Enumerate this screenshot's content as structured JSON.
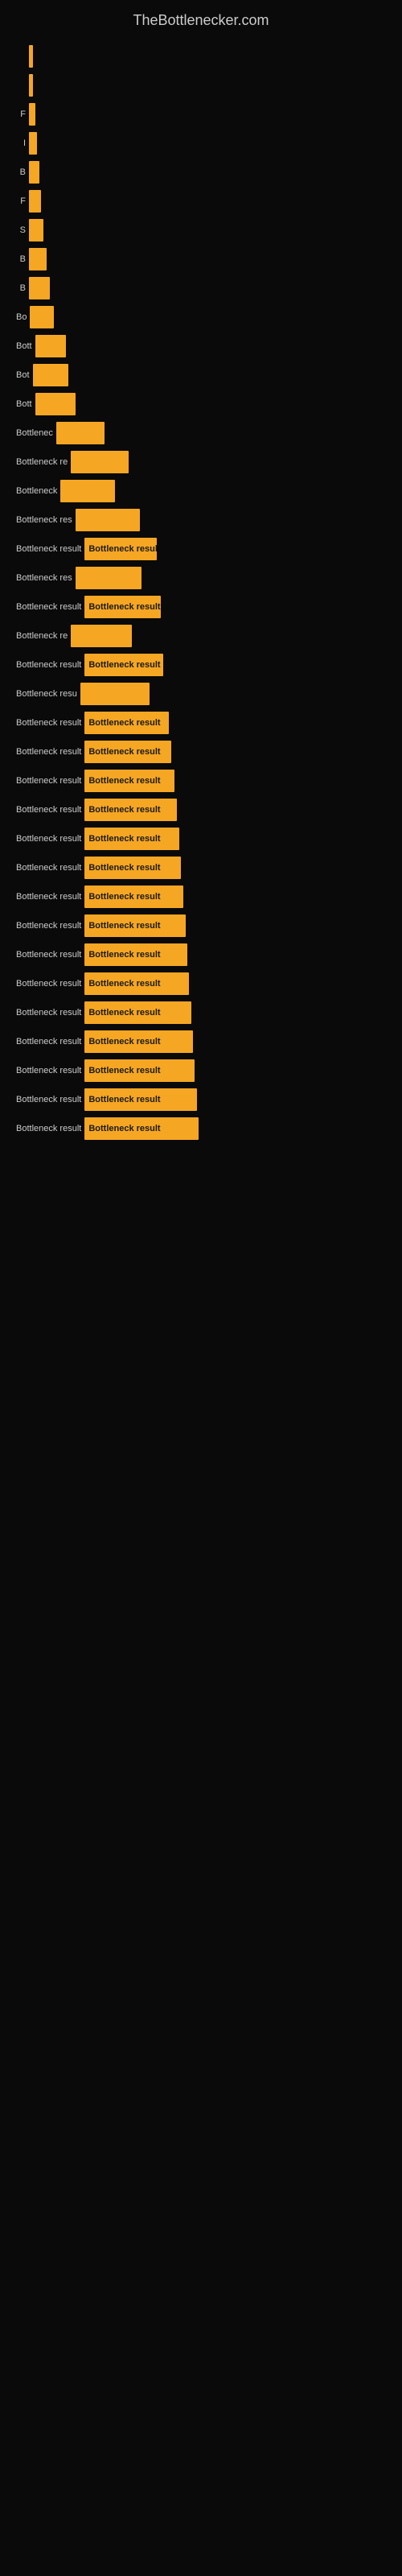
{
  "site": {
    "title": "TheBottlenecker.com"
  },
  "chart": {
    "bars": [
      {
        "label": "",
        "width": 4,
        "text": ""
      },
      {
        "label": "",
        "width": 5,
        "text": ""
      },
      {
        "label": "F",
        "width": 8,
        "text": ""
      },
      {
        "label": "I",
        "width": 10,
        "text": ""
      },
      {
        "label": "B",
        "width": 13,
        "text": ""
      },
      {
        "label": "F",
        "width": 15,
        "text": ""
      },
      {
        "label": "S",
        "width": 18,
        "text": ""
      },
      {
        "label": "B",
        "width": 22,
        "text": ""
      },
      {
        "label": "B",
        "width": 26,
        "text": ""
      },
      {
        "label": "Bo",
        "width": 30,
        "text": ""
      },
      {
        "label": "Bott",
        "width": 38,
        "text": ""
      },
      {
        "label": "Bot",
        "width": 44,
        "text": ""
      },
      {
        "label": "Bott",
        "width": 50,
        "text": ""
      },
      {
        "label": "Bottlenec",
        "width": 60,
        "text": ""
      },
      {
        "label": "Bottleneck re",
        "width": 72,
        "text": ""
      },
      {
        "label": "Bottleneck",
        "width": 68,
        "text": ""
      },
      {
        "label": "Bottleneck res",
        "width": 80,
        "text": ""
      },
      {
        "label": "Bottleneck result",
        "width": 90,
        "text": "Bottleneck result"
      },
      {
        "label": "Bottleneck res",
        "width": 82,
        "text": ""
      },
      {
        "label": "Bottleneck result",
        "width": 95,
        "text": "Bottleneck result"
      },
      {
        "label": "Bottleneck re",
        "width": 76,
        "text": ""
      },
      {
        "label": "Bottleneck result",
        "width": 98,
        "text": "Bottleneck result"
      },
      {
        "label": "Bottleneck resu",
        "width": 86,
        "text": ""
      },
      {
        "label": "Bottleneck result",
        "width": 105,
        "text": "Bottleneck result"
      },
      {
        "label": "Bottleneck result",
        "width": 108,
        "text": "Bottleneck result"
      },
      {
        "label": "Bottleneck result",
        "width": 112,
        "text": "Bottleneck result"
      },
      {
        "label": "Bottleneck result",
        "width": 115,
        "text": "Bottleneck result"
      },
      {
        "label": "Bottleneck result",
        "width": 118,
        "text": "Bottleneck result"
      },
      {
        "label": "Bottleneck result",
        "width": 120,
        "text": "Bottleneck result"
      },
      {
        "label": "Bottleneck result",
        "width": 123,
        "text": "Bottleneck result"
      },
      {
        "label": "Bottleneck result",
        "width": 126,
        "text": "Bottleneck result"
      },
      {
        "label": "Bottleneck result",
        "width": 128,
        "text": "Bottleneck result"
      },
      {
        "label": "Bottleneck result",
        "width": 130,
        "text": "Bottleneck result"
      },
      {
        "label": "Bottleneck result",
        "width": 133,
        "text": "Bottleneck result"
      },
      {
        "label": "Bottleneck result",
        "width": 135,
        "text": "Bottleneck result"
      },
      {
        "label": "Bottleneck result",
        "width": 137,
        "text": "Bottleneck result"
      },
      {
        "label": "Bottleneck result",
        "width": 140,
        "text": "Bottleneck result"
      },
      {
        "label": "Bottleneck result",
        "width": 142,
        "text": "Bottleneck result"
      }
    ]
  }
}
